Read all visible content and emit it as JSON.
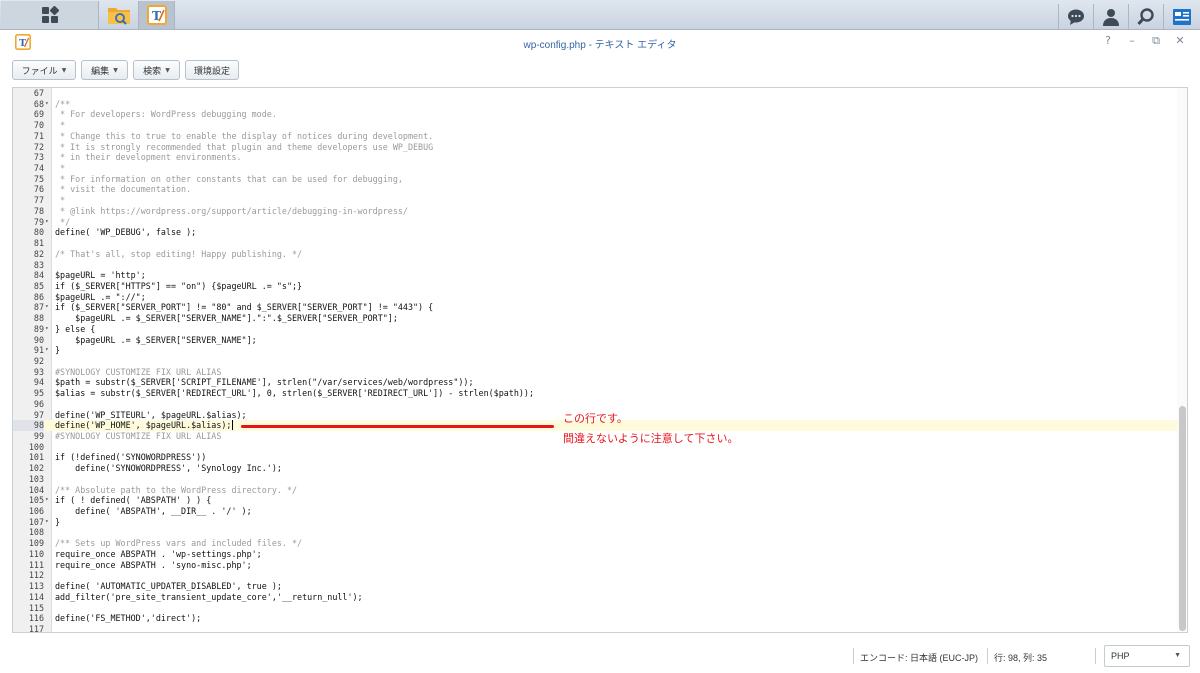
{
  "taskbar": {
    "apps": [
      {
        "icon": "main-menu-grid-icon"
      },
      {
        "icon": "file-station-icon"
      },
      {
        "icon": "text-editor-icon"
      }
    ],
    "tray": [
      "chat-icon",
      "user-icon",
      "search-icon",
      "widgets-icon"
    ]
  },
  "window": {
    "title": "wp-config.php - テキスト エディタ",
    "controls": {
      "help": "?",
      "minimize": "–",
      "restore": "⧉",
      "close": "✕"
    }
  },
  "toolbar": {
    "file_label": "ファイル",
    "edit_label": "編集",
    "search_label": "検索",
    "settings_label": "環境設定"
  },
  "editor": {
    "active_line": 98,
    "lines": [
      {
        "n": "67",
        "fold": false,
        "t": ""
      },
      {
        "n": "68",
        "fold": true,
        "t": "/**"
      },
      {
        "n": "69",
        "fold": false,
        "t": " * For developers: WordPress debugging mode."
      },
      {
        "n": "70",
        "fold": false,
        "t": " *"
      },
      {
        "n": "71",
        "fold": false,
        "t": " * Change this to true to enable the display of notices during development."
      },
      {
        "n": "72",
        "fold": false,
        "t": " * It is strongly recommended that plugin and theme developers use WP_DEBUG"
      },
      {
        "n": "73",
        "fold": false,
        "t": " * in their development environments."
      },
      {
        "n": "74",
        "fold": false,
        "t": " *"
      },
      {
        "n": "75",
        "fold": false,
        "t": " * For information on other constants that can be used for debugging,"
      },
      {
        "n": "76",
        "fold": false,
        "t": " * visit the documentation."
      },
      {
        "n": "77",
        "fold": false,
        "t": " *"
      },
      {
        "n": "78",
        "fold": false,
        "t": " * @link https://wordpress.org/support/article/debugging-in-wordpress/"
      },
      {
        "n": "79",
        "fold": true,
        "t": " */"
      },
      {
        "n": "80",
        "fold": false,
        "t": "define( 'WP_DEBUG', false );"
      },
      {
        "n": "81",
        "fold": false,
        "t": ""
      },
      {
        "n": "82",
        "fold": false,
        "t": "/* That's all, stop editing! Happy publishing. */"
      },
      {
        "n": "83",
        "fold": false,
        "t": ""
      },
      {
        "n": "84",
        "fold": false,
        "t": "$pageURL = 'http';"
      },
      {
        "n": "85",
        "fold": false,
        "t": "if ($_SERVER[\"HTTPS\"] == \"on\") {$pageURL .= \"s\";}"
      },
      {
        "n": "86",
        "fold": false,
        "t": "$pageURL .= \"://\";"
      },
      {
        "n": "87",
        "fold": true,
        "t": "if ($_SERVER[\"SERVER_PORT\"] != \"80\" and $_SERVER[\"SERVER_PORT\"] != \"443\") {"
      },
      {
        "n": "88",
        "fold": false,
        "t": "    $pageURL .= $_SERVER[\"SERVER_NAME\"].\":\".$_SERVER[\"SERVER_PORT\"];"
      },
      {
        "n": "89",
        "fold": true,
        "t": "} else {"
      },
      {
        "n": "90",
        "fold": false,
        "t": "    $pageURL .= $_SERVER[\"SERVER_NAME\"];"
      },
      {
        "n": "91",
        "fold": true,
        "t": "}"
      },
      {
        "n": "92",
        "fold": false,
        "t": ""
      },
      {
        "n": "93",
        "fold": false,
        "t": "#SYNOLOGY CUSTOMIZE FIX URL ALIAS"
      },
      {
        "n": "94",
        "fold": false,
        "t": "$path = substr($_SERVER['SCRIPT_FILENAME'], strlen(\"/var/services/web/wordpress\"));"
      },
      {
        "n": "95",
        "fold": false,
        "t": "$alias = substr($_SERVER['REDIRECT_URL'], 0, strlen($_SERVER['REDIRECT_URL']) - strlen($path));"
      },
      {
        "n": "96",
        "fold": false,
        "t": ""
      },
      {
        "n": "97",
        "fold": false,
        "t": "define('WP_SITEURL', $pageURL.$alias);"
      },
      {
        "n": "98",
        "fold": false,
        "t": "define('WP_HOME', $pageURL.$alias);"
      },
      {
        "n": "99",
        "fold": false,
        "t": "#SYNOLOGY CUSTOMIZE FIX URL ALIAS"
      },
      {
        "n": "100",
        "fold": false,
        "t": ""
      },
      {
        "n": "101",
        "fold": false,
        "t": "if (!defined('SYNOWORDPRESS'))"
      },
      {
        "n": "102",
        "fold": false,
        "t": "    define('SYNOWORDPRESS', 'Synology Inc.');"
      },
      {
        "n": "103",
        "fold": false,
        "t": ""
      },
      {
        "n": "104",
        "fold": false,
        "t": "/** Absolute path to the WordPress directory. */"
      },
      {
        "n": "105",
        "fold": true,
        "t": "if ( ! defined( 'ABSPATH' ) ) {"
      },
      {
        "n": "106",
        "fold": false,
        "t": "    define( 'ABSPATH', __DIR__ . '/' );"
      },
      {
        "n": "107",
        "fold": true,
        "t": "}"
      },
      {
        "n": "108",
        "fold": false,
        "t": ""
      },
      {
        "n": "109",
        "fold": false,
        "t": "/** Sets up WordPress vars and included files. */"
      },
      {
        "n": "110",
        "fold": false,
        "t": "require_once ABSPATH . 'wp-settings.php';"
      },
      {
        "n": "111",
        "fold": false,
        "t": "require_once ABSPATH . 'syno-misc.php';"
      },
      {
        "n": "112",
        "fold": false,
        "t": ""
      },
      {
        "n": "113",
        "fold": false,
        "t": "define( 'AUTOMATIC_UPDATER_DISABLED', true );"
      },
      {
        "n": "114",
        "fold": false,
        "t": "add_filter('pre_site_transient_update_core','__return_null');"
      },
      {
        "n": "115",
        "fold": false,
        "t": ""
      },
      {
        "n": "116",
        "fold": false,
        "t": "define('FS_METHOD','direct');"
      },
      {
        "n": "117",
        "fold": false,
        "t": ""
      }
    ]
  },
  "annotation": {
    "line1": "この行です。",
    "line2": "間違えないように注意して下さい。",
    "color": "#e8141b"
  },
  "statusbar": {
    "encoding": "エンコード: 日本語 (EUC-JP)",
    "position": "行: 98, 列: 35",
    "language": "PHP"
  }
}
